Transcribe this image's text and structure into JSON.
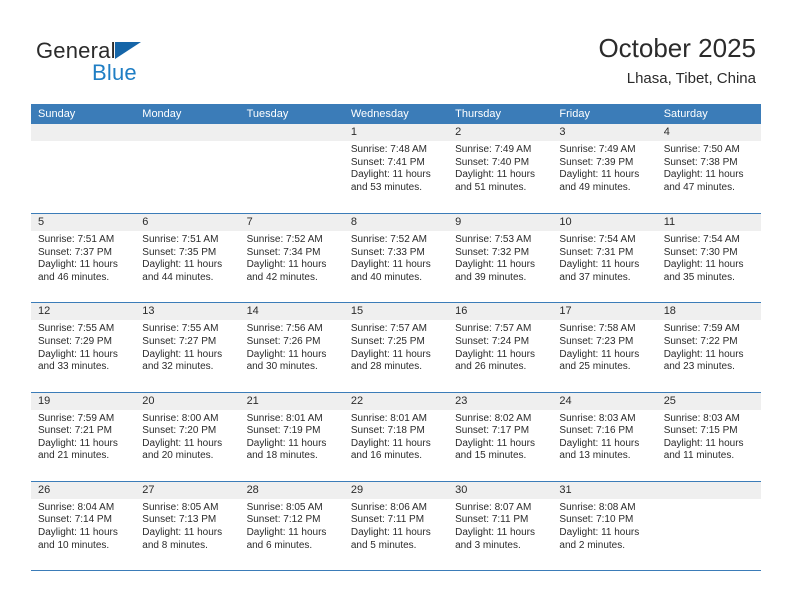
{
  "brand": {
    "name_line1": "General",
    "name_line2": "Blue",
    "triangle_color": "#1565a8",
    "blue_color": "#1f7ec4"
  },
  "header": {
    "title": "October 2025",
    "subtitle": "Lhasa, Tibet, China"
  },
  "theme": {
    "header_blue": "#3b7cb8",
    "date_band_gray": "#efefef",
    "text_color": "#2b2b2b"
  },
  "calendar": {
    "day_headers": [
      "Sunday",
      "Monday",
      "Tuesday",
      "Wednesday",
      "Thursday",
      "Friday",
      "Saturday"
    ],
    "weeks": [
      [
        {
          "date": "",
          "lines": []
        },
        {
          "date": "",
          "lines": []
        },
        {
          "date": "",
          "lines": []
        },
        {
          "date": "1",
          "lines": [
            "Sunrise: 7:48 AM",
            "Sunset: 7:41 PM",
            "Daylight: 11 hours",
            "and 53 minutes."
          ]
        },
        {
          "date": "2",
          "lines": [
            "Sunrise: 7:49 AM",
            "Sunset: 7:40 PM",
            "Daylight: 11 hours",
            "and 51 minutes."
          ]
        },
        {
          "date": "3",
          "lines": [
            "Sunrise: 7:49 AM",
            "Sunset: 7:39 PM",
            "Daylight: 11 hours",
            "and 49 minutes."
          ]
        },
        {
          "date": "4",
          "lines": [
            "Sunrise: 7:50 AM",
            "Sunset: 7:38 PM",
            "Daylight: 11 hours",
            "and 47 minutes."
          ]
        }
      ],
      [
        {
          "date": "5",
          "lines": [
            "Sunrise: 7:51 AM",
            "Sunset: 7:37 PM",
            "Daylight: 11 hours",
            "and 46 minutes."
          ]
        },
        {
          "date": "6",
          "lines": [
            "Sunrise: 7:51 AM",
            "Sunset: 7:35 PM",
            "Daylight: 11 hours",
            "and 44 minutes."
          ]
        },
        {
          "date": "7",
          "lines": [
            "Sunrise: 7:52 AM",
            "Sunset: 7:34 PM",
            "Daylight: 11 hours",
            "and 42 minutes."
          ]
        },
        {
          "date": "8",
          "lines": [
            "Sunrise: 7:52 AM",
            "Sunset: 7:33 PM",
            "Daylight: 11 hours",
            "and 40 minutes."
          ]
        },
        {
          "date": "9",
          "lines": [
            "Sunrise: 7:53 AM",
            "Sunset: 7:32 PM",
            "Daylight: 11 hours",
            "and 39 minutes."
          ]
        },
        {
          "date": "10",
          "lines": [
            "Sunrise: 7:54 AM",
            "Sunset: 7:31 PM",
            "Daylight: 11 hours",
            "and 37 minutes."
          ]
        },
        {
          "date": "11",
          "lines": [
            "Sunrise: 7:54 AM",
            "Sunset: 7:30 PM",
            "Daylight: 11 hours",
            "and 35 minutes."
          ]
        }
      ],
      [
        {
          "date": "12",
          "lines": [
            "Sunrise: 7:55 AM",
            "Sunset: 7:29 PM",
            "Daylight: 11 hours",
            "and 33 minutes."
          ]
        },
        {
          "date": "13",
          "lines": [
            "Sunrise: 7:55 AM",
            "Sunset: 7:27 PM",
            "Daylight: 11 hours",
            "and 32 minutes."
          ]
        },
        {
          "date": "14",
          "lines": [
            "Sunrise: 7:56 AM",
            "Sunset: 7:26 PM",
            "Daylight: 11 hours",
            "and 30 minutes."
          ]
        },
        {
          "date": "15",
          "lines": [
            "Sunrise: 7:57 AM",
            "Sunset: 7:25 PM",
            "Daylight: 11 hours",
            "and 28 minutes."
          ]
        },
        {
          "date": "16",
          "lines": [
            "Sunrise: 7:57 AM",
            "Sunset: 7:24 PM",
            "Daylight: 11 hours",
            "and 26 minutes."
          ]
        },
        {
          "date": "17",
          "lines": [
            "Sunrise: 7:58 AM",
            "Sunset: 7:23 PM",
            "Daylight: 11 hours",
            "and 25 minutes."
          ]
        },
        {
          "date": "18",
          "lines": [
            "Sunrise: 7:59 AM",
            "Sunset: 7:22 PM",
            "Daylight: 11 hours",
            "and 23 minutes."
          ]
        }
      ],
      [
        {
          "date": "19",
          "lines": [
            "Sunrise: 7:59 AM",
            "Sunset: 7:21 PM",
            "Daylight: 11 hours",
            "and 21 minutes."
          ]
        },
        {
          "date": "20",
          "lines": [
            "Sunrise: 8:00 AM",
            "Sunset: 7:20 PM",
            "Daylight: 11 hours",
            "and 20 minutes."
          ]
        },
        {
          "date": "21",
          "lines": [
            "Sunrise: 8:01 AM",
            "Sunset: 7:19 PM",
            "Daylight: 11 hours",
            "and 18 minutes."
          ]
        },
        {
          "date": "22",
          "lines": [
            "Sunrise: 8:01 AM",
            "Sunset: 7:18 PM",
            "Daylight: 11 hours",
            "and 16 minutes."
          ]
        },
        {
          "date": "23",
          "lines": [
            "Sunrise: 8:02 AM",
            "Sunset: 7:17 PM",
            "Daylight: 11 hours",
            "and 15 minutes."
          ]
        },
        {
          "date": "24",
          "lines": [
            "Sunrise: 8:03 AM",
            "Sunset: 7:16 PM",
            "Daylight: 11 hours",
            "and 13 minutes."
          ]
        },
        {
          "date": "25",
          "lines": [
            "Sunrise: 8:03 AM",
            "Sunset: 7:15 PM",
            "Daylight: 11 hours",
            "and 11 minutes."
          ]
        }
      ],
      [
        {
          "date": "26",
          "lines": [
            "Sunrise: 8:04 AM",
            "Sunset: 7:14 PM",
            "Daylight: 11 hours",
            "and 10 minutes."
          ]
        },
        {
          "date": "27",
          "lines": [
            "Sunrise: 8:05 AM",
            "Sunset: 7:13 PM",
            "Daylight: 11 hours",
            "and 8 minutes."
          ]
        },
        {
          "date": "28",
          "lines": [
            "Sunrise: 8:05 AM",
            "Sunset: 7:12 PM",
            "Daylight: 11 hours",
            "and 6 minutes."
          ]
        },
        {
          "date": "29",
          "lines": [
            "Sunrise: 8:06 AM",
            "Sunset: 7:11 PM",
            "Daylight: 11 hours",
            "and 5 minutes."
          ]
        },
        {
          "date": "30",
          "lines": [
            "Sunrise: 8:07 AM",
            "Sunset: 7:11 PM",
            "Daylight: 11 hours",
            "and 3 minutes."
          ]
        },
        {
          "date": "31",
          "lines": [
            "Sunrise: 8:08 AM",
            "Sunset: 7:10 PM",
            "Daylight: 11 hours",
            "and 2 minutes."
          ]
        },
        {
          "date": "",
          "lines": []
        }
      ]
    ]
  }
}
